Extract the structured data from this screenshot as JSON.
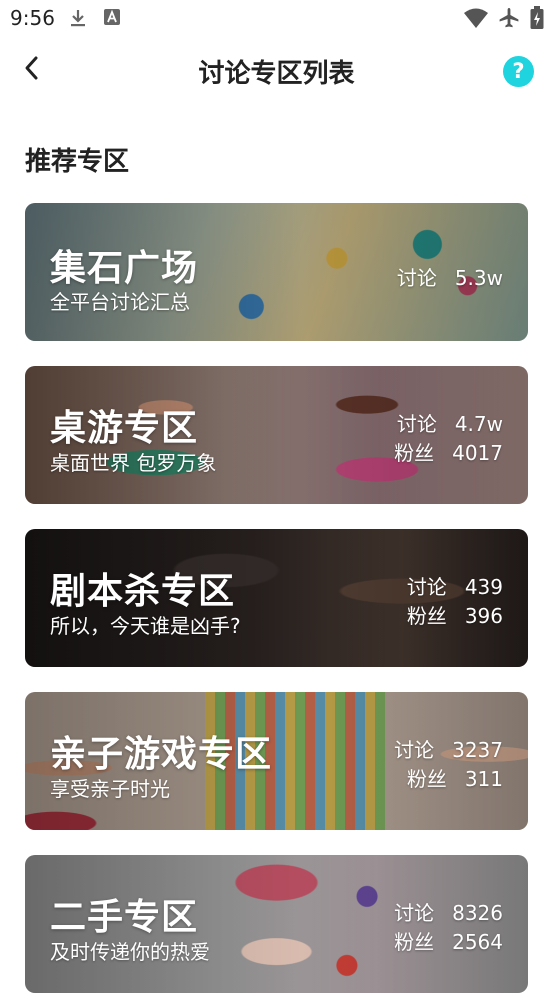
{
  "status_bar": {
    "time": "9:56",
    "icons": [
      "download-icon",
      "a-badge-icon",
      "wifi-icon",
      "airplane-icon",
      "battery-charging-icon"
    ]
  },
  "header": {
    "back_icon": "chevron-left-icon",
    "title": "讨论专区列表",
    "help_label": "?"
  },
  "section_title": "推荐专区",
  "cards": [
    {
      "title": "集石广场",
      "subtitle": "全平台讨论汇总",
      "discuss_label": "讨论",
      "discuss_value": "5.3w"
    },
    {
      "title": "桌游专区",
      "subtitle": "桌面世界 包罗万象",
      "discuss_label": "讨论",
      "discuss_value": "4.7w",
      "fans_label": "粉丝",
      "fans_value": "4017"
    },
    {
      "title": "剧本杀专区",
      "subtitle": "所以，今天谁是凶手?",
      "discuss_label": "讨论",
      "discuss_value": "439",
      "fans_label": "粉丝",
      "fans_value": "396"
    },
    {
      "title": "亲子游戏专区",
      "subtitle": "享受亲子时光",
      "discuss_label": "讨论",
      "discuss_value": "3237",
      "fans_label": "粉丝",
      "fans_value": "311"
    },
    {
      "title": "二手专区",
      "subtitle": "及时传递你的热爱",
      "discuss_label": "讨论",
      "discuss_value": "8326",
      "fans_label": "粉丝",
      "fans_value": "2564"
    }
  ],
  "colors": {
    "accent": "#1fd3df",
    "card_text": "#ffffff"
  }
}
